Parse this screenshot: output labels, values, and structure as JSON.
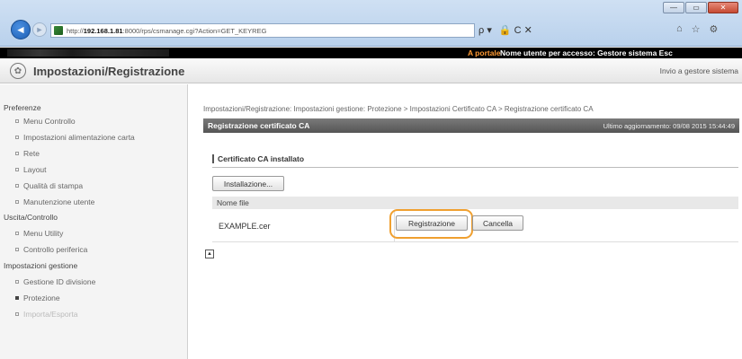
{
  "browser": {
    "url_prefix": "http://",
    "url_host": "192.168.1.81",
    "url_rest": ":8000/rps/csmanage.cgi?Action=GET_KEYREG",
    "search_glyph": "ρ ▾",
    "addr_glyphs": "🔒 C ✕",
    "minimize": "—",
    "maximize": "▭",
    "close": "✕"
  },
  "portal": {
    "link": "A portale",
    "user": "Nome utente per accesso: Gestore sistema Esc"
  },
  "header": {
    "title": "Impostazioni/Registrazione",
    "send_link": "Invio a gestore sistema"
  },
  "sidebar": {
    "sections": [
      {
        "label": "Preferenze",
        "items": [
          "Menu Controllo",
          "Impostazioni alimentazione carta",
          "Rete",
          "Layout",
          "Qualità di stampa",
          "Manutenzione utente"
        ]
      },
      {
        "label": "Uscita/Controllo",
        "items": [
          "Menu Utility",
          "Controllo periferica"
        ]
      },
      {
        "label": "Impostazioni gestione",
        "items": [
          "Gestione ID divisione",
          "Protezione",
          "Importa/Esporta"
        ]
      }
    ]
  },
  "main": {
    "breadcrumb": "Impostazioni/Registrazione: Impostazioni gestione: Protezione > Impostazioni Certificato CA > Registrazione certificato CA",
    "heading": "Registrazione certificato CA",
    "last_update": "Ultimo aggiornamento: 09/08 2015 15:44:49",
    "section_title": "Certificato CA installato",
    "install_button": "Installazione...",
    "col_filename": "Nome file",
    "rows": [
      {
        "filename": "EXAMPLE.cer",
        "register": "Registrazione",
        "delete": "Cancella"
      }
    ],
    "page_top_icon": "▲"
  },
  "colors": {
    "highlight": "#f0a030",
    "portal_link": "#ff9a33"
  }
}
